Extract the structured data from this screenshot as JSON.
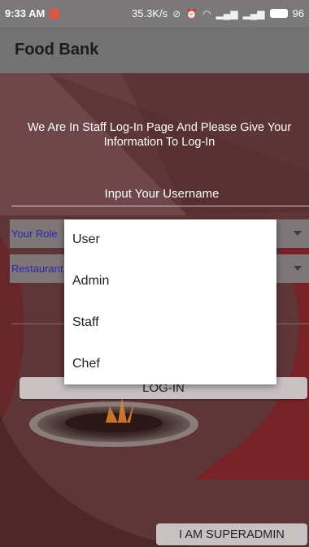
{
  "status_bar": {
    "time": "9:33 AM",
    "speed": "35.3K/s",
    "battery": "96"
  },
  "app": {
    "title": "Food Bank"
  },
  "form": {
    "intro_text": "We Are In Staff Log-In Page And Please Give Your Information To Log-In",
    "username_placeholder": "Input Your Username",
    "role_value": "Your Role",
    "restaurant_value": "Restaurant",
    "login_label": "LOG-IN",
    "superadmin_label": "I AM SUPERADMIN"
  },
  "role_dropdown": {
    "options": [
      "User",
      "Admin",
      "Staff",
      "Chef"
    ]
  },
  "colors": {
    "app_bar": "#737373",
    "background": "#5b3537",
    "spinner_text": "#2a24b8"
  }
}
